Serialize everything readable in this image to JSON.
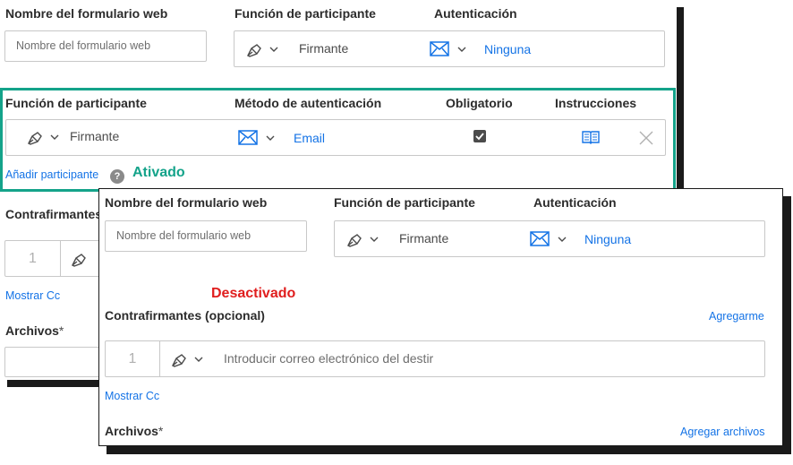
{
  "back": {
    "web_form_name_label": "Nombre del formulario web",
    "web_form_name_placeholder": "Nombre del formulario web",
    "participant_role_label": "Función de participante",
    "participant_role_value": "Firmante",
    "authentication_label": "Autenticación",
    "authentication_value": "Ninguna",
    "countersigners_label": "Contrafirmantes",
    "order_number": "1",
    "show_cc": "Mostrar Cc",
    "files_label": "Archivos",
    "required_mark": "*"
  },
  "highlight": {
    "role_label": "Función de participante",
    "auth_method_label": "Método de autenticación",
    "required_label": "Obligatorio",
    "instructions_label": "Instrucciones",
    "role_value": "Firmante",
    "auth_value": "Email",
    "required_checked": true,
    "add_participant": "Añadir participante",
    "help": "?",
    "status": "Ativado"
  },
  "front": {
    "web_form_name_label": "Nombre del formulario web",
    "web_form_name_placeholder": "Nombre del formulario web",
    "participant_role_label": "Función de participante",
    "participant_role_value": "Firmante",
    "authentication_label": "Autenticación",
    "authentication_value": "Ninguna",
    "status": "Desactivado",
    "countersigners_label": "Contrafirmantes (opcional)",
    "add_me": "Agregarme",
    "order_number": "1",
    "email_placeholder": "Introducir correo electrónico del destir",
    "show_cc": "Mostrar Cc",
    "files_label": "Archivos",
    "required_mark": "*",
    "add_files": "Agregar archivos"
  },
  "colors": {
    "highlight_border": "#14a38a",
    "link_blue": "#1473e6",
    "disabled_red": "#e01e1e",
    "shadow": "#1a1a1a"
  },
  "icons": [
    "pen-icon",
    "chevron-down-icon",
    "envelope-icon",
    "book-icon",
    "close-icon",
    "help-icon",
    "checkbox-icon"
  ]
}
